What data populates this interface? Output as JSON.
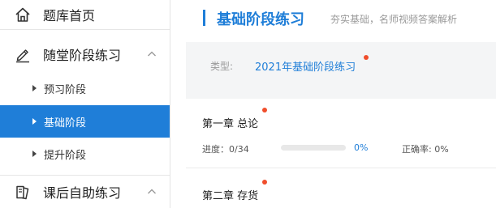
{
  "sidebar": {
    "home_label": "题库首页",
    "group1": {
      "label": "随堂阶段练习",
      "items": [
        {
          "label": "预习阶段"
        },
        {
          "label": "基础阶段"
        },
        {
          "label": "提升阶段"
        }
      ],
      "active_index": 1
    },
    "group2": {
      "label": "课后自助练习"
    }
  },
  "main": {
    "title": "基础阶段练习",
    "subtitle": "夯实基础，名师视频答案解析",
    "type_label": "类型:",
    "type_value": "2021年基础阶段练习",
    "chapters": [
      {
        "title": "第一章 总论",
        "progress_label": "进度：0/34",
        "progress_fraction": 0,
        "progress_percent": "0%",
        "accuracy_label": "正确率: 0%"
      },
      {
        "title": "第二章 存货"
      }
    ]
  },
  "colors": {
    "accent": "#1f7ed8",
    "badge_dot": "#f04e2c",
    "panel_bg": "#f4f5f6"
  },
  "icons": {
    "home": "home-icon",
    "practice": "pencil-icon",
    "self_practice": "book-icon",
    "collapse": "chevron-up-icon",
    "bullet": "caret-right-icon"
  }
}
